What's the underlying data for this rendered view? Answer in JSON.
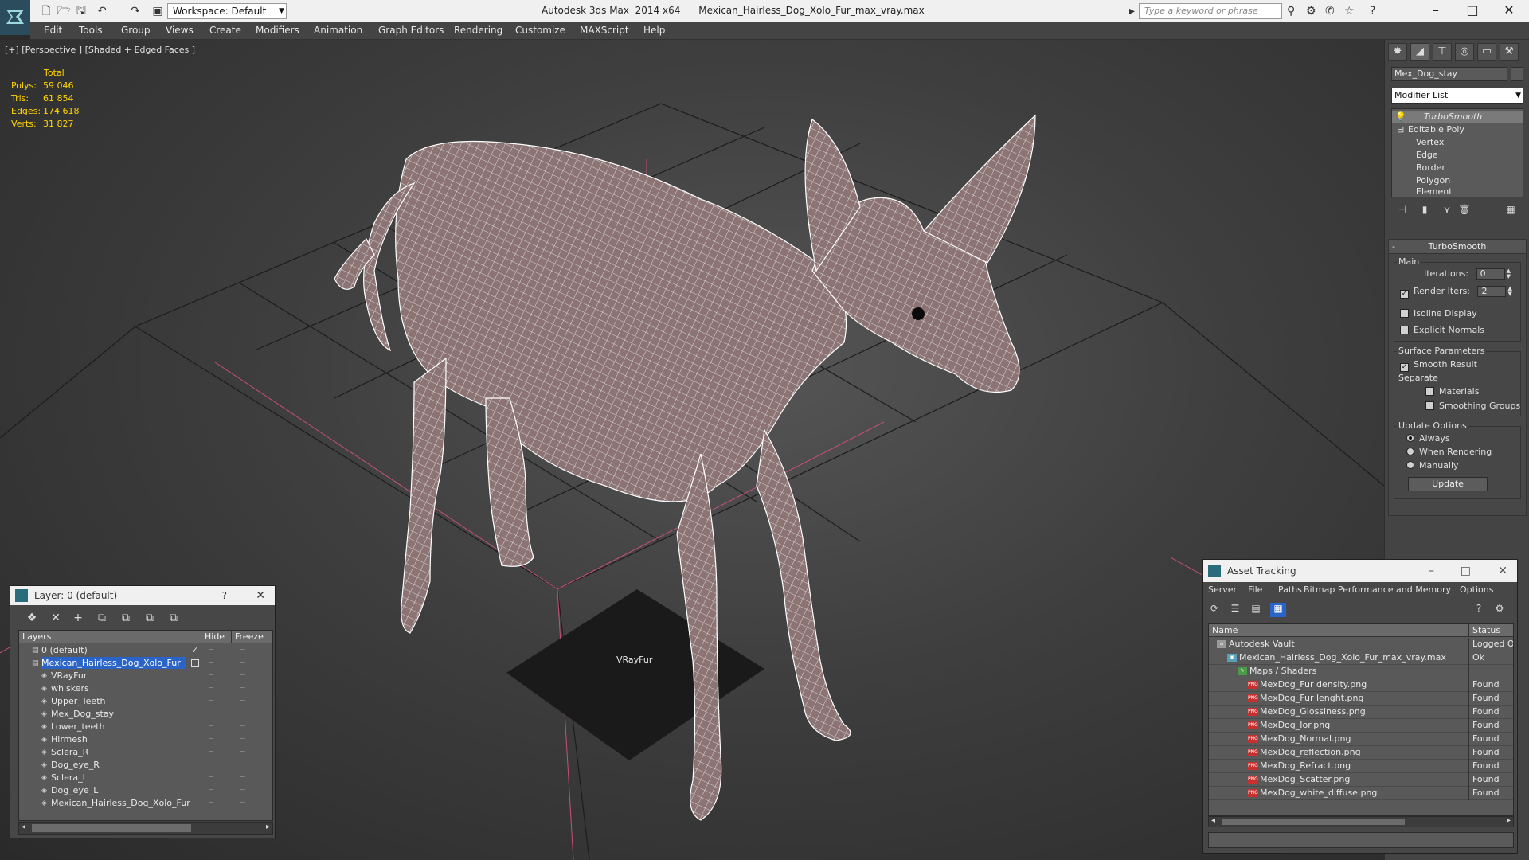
{
  "titlebar": {
    "workspace": "Workspace: Default",
    "app_name": "Autodesk 3ds Max  2014 x64",
    "file_name": "Mexican_Hairless_Dog_Xolo_Fur_max_vray.max",
    "search_placeholder": "Type a keyword or phrase"
  },
  "menu": [
    "Edit",
    "Tools",
    "Group",
    "Views",
    "Create",
    "Modifiers",
    "Animation",
    "Graph Editors",
    "Rendering",
    "Customize",
    "MAXScript",
    "Help"
  ],
  "viewport": {
    "label": "[+] [Perspective ] [Shaded + Edged Faces ]",
    "stats_header": "Total",
    "stats": [
      {
        "label": "Polys:",
        "value": "59 046"
      },
      {
        "label": "Tris:",
        "value": "61 854"
      },
      {
        "label": "Edges:",
        "value": "174 618"
      },
      {
        "label": "Verts:",
        "value": "31 827"
      }
    ],
    "object_label": "VRayFur",
    "colors": {
      "mesh_fill": "#8c7474",
      "wire": "#ffffff",
      "grid_red": "#c8507a"
    }
  },
  "command_panel": {
    "object_name": "Mex_Dog_stay",
    "modifier_list": "Modifier List",
    "stack": [
      {
        "label": "TurboSmooth",
        "selected": true
      },
      {
        "label": "Editable Poly"
      },
      {
        "label": "Vertex"
      },
      {
        "label": "Edge"
      },
      {
        "label": "Border"
      },
      {
        "label": "Polygon"
      },
      {
        "label": "Element"
      }
    ],
    "turbosmooth": {
      "title": "TurboSmooth",
      "main_group": "Main",
      "iterations_label": "Iterations:",
      "iterations_value": "0",
      "render_iters_label": "Render Iters:",
      "render_iters_value": "2",
      "isoline_display": "Isoline Display",
      "explicit_normals": "Explicit Normals",
      "surface_group": "Surface Parameters",
      "smooth_result": "Smooth Result",
      "separate": "Separate",
      "materials": "Materials",
      "smoothing_groups": "Smoothing Groups",
      "update_group": "Update Options",
      "always": "Always",
      "when_rendering": "When Rendering",
      "manually": "Manually",
      "update_button": "Update"
    }
  },
  "layer_dialog": {
    "title": "Layer: 0 (default)",
    "help": "?",
    "columns": {
      "layers": "Layers",
      "hide": "Hide",
      "freeze": "Freeze"
    },
    "rows": [
      {
        "name": "0 (default)",
        "level": 0
      },
      {
        "name": "Mexican_Hairless_Dog_Xolo_Fur",
        "level": 0,
        "selected": true
      },
      {
        "name": "VRayFur",
        "level": 1
      },
      {
        "name": "whiskers",
        "level": 1
      },
      {
        "name": "Upper_Teeth",
        "level": 1
      },
      {
        "name": "Mex_Dog_stay",
        "level": 1
      },
      {
        "name": "Lower_teeth",
        "level": 1
      },
      {
        "name": "Hirmesh",
        "level": 1
      },
      {
        "name": "Sclera_R",
        "level": 1
      },
      {
        "name": "Dog_eye_R",
        "level": 1
      },
      {
        "name": "Sclera_L",
        "level": 1
      },
      {
        "name": "Dog_eye_L",
        "level": 1
      },
      {
        "name": "Mexican_Hairless_Dog_Xolo_Fur",
        "level": 1
      }
    ]
  },
  "asset_dialog": {
    "title": "Asset Tracking",
    "menu": [
      "Server",
      "File",
      "Paths",
      "Bitmap Performance and Memory",
      "Options"
    ],
    "columns": {
      "name": "Name",
      "status": "Status"
    },
    "rows": [
      {
        "name": "Autodesk Vault",
        "status": "Logged Out",
        "level": 0,
        "icon": "vault"
      },
      {
        "name": "Mexican_Hairless_Dog_Xolo_Fur_max_vray.max",
        "status": "Ok",
        "level": 1,
        "icon": "max-file"
      },
      {
        "name": "Maps / Shaders",
        "status": "",
        "level": 2,
        "icon": "maps"
      },
      {
        "name": "MexDog_Fur density.png",
        "status": "Found",
        "level": 3,
        "icon": "png"
      },
      {
        "name": "MexDog_Fur lenght.png",
        "status": "Found",
        "level": 3,
        "icon": "png"
      },
      {
        "name": "MexDog_Glossiness.png",
        "status": "Found",
        "level": 3,
        "icon": "png"
      },
      {
        "name": "MexDog_Ior.png",
        "status": "Found",
        "level": 3,
        "icon": "png"
      },
      {
        "name": "MexDog_Normal.png",
        "status": "Found",
        "level": 3,
        "icon": "png"
      },
      {
        "name": "MexDog_reflection.png",
        "status": "Found",
        "level": 3,
        "icon": "png"
      },
      {
        "name": "MexDog_Refract.png",
        "status": "Found",
        "level": 3,
        "icon": "png"
      },
      {
        "name": "MexDog_Scatter.png",
        "status": "Found",
        "level": 3,
        "icon": "png"
      },
      {
        "name": "MexDog_white_diffuse.png",
        "status": "Found",
        "level": 3,
        "icon": "png"
      }
    ]
  }
}
